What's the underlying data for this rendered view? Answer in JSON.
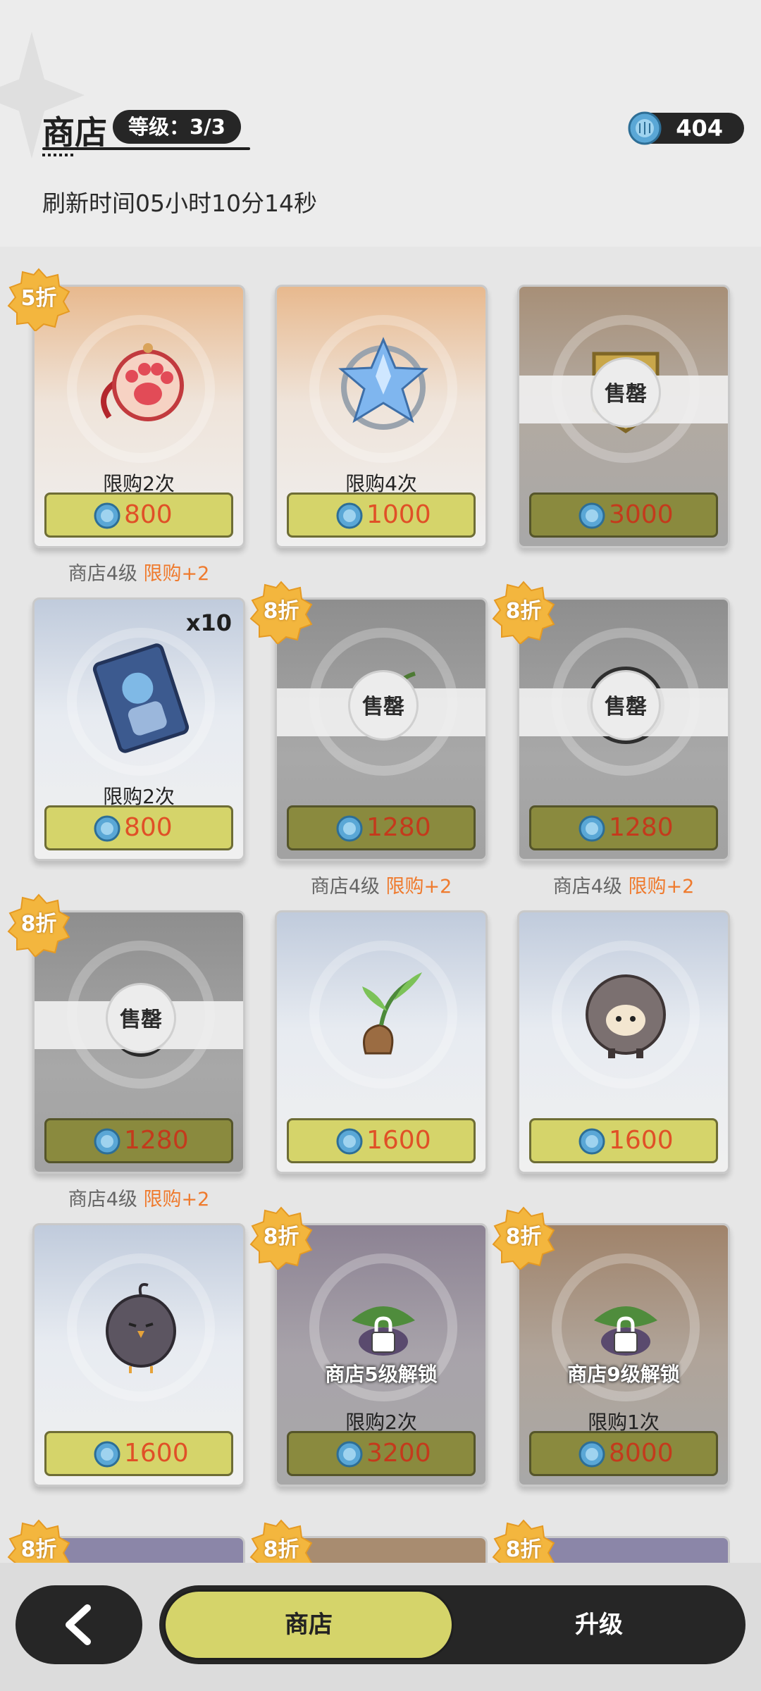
{
  "header": {
    "title": "商店",
    "level": "等级：3/3",
    "currency_amount": "404",
    "refresh_text": "刷新时间05小时10分14秒"
  },
  "items": [
    {
      "limit": "限购2次",
      "price": "800",
      "discount": "5折",
      "note_prefix": "商店4级",
      "note_highlight": "限购+2",
      "sold_out": false,
      "art": "paw-pendant-icon"
    },
    {
      "limit": "限购4次",
      "price": "1000",
      "sold_out": false,
      "art": "crystal-star-icon"
    },
    {
      "price": "3000",
      "sold_out": true,
      "sold_out_label": "售罄",
      "art": "badge-icon"
    },
    {
      "limit": "限购2次",
      "price": "800",
      "quantity": "x10",
      "sold_out": false,
      "art": "character-card-icon"
    },
    {
      "price": "1280",
      "discount": "8折",
      "sold_out": true,
      "sold_out_label": "售罄",
      "note_prefix": "商店4级",
      "note_highlight": "限购+2",
      "art": "sprout-icon"
    },
    {
      "price": "1280",
      "discount": "8折",
      "sold_out": true,
      "sold_out_label": "售罄",
      "note_prefix": "商店4级",
      "note_highlight": "限购+2",
      "art": "sheep-icon"
    },
    {
      "price": "1280",
      "discount": "8折",
      "sold_out": true,
      "sold_out_label": "售罄",
      "note_prefix": "商店4级",
      "note_highlight": "限购+2",
      "art": "bird-icon"
    },
    {
      "price": "1600",
      "sold_out": false,
      "art": "sprout-icon"
    },
    {
      "price": "1600",
      "sold_out": false,
      "art": "sheep-icon"
    },
    {
      "price": "1600",
      "sold_out": false,
      "art": "bird-icon"
    },
    {
      "limit": "限购2次",
      "price": "3200",
      "discount": "8折",
      "locked_label": "商店5级解锁",
      "art": "plant-bundle-icon"
    },
    {
      "limit": "限购1次",
      "price": "8000",
      "discount": "8折",
      "locked_label": "商店9级解锁",
      "art": "plant-bundle-icon"
    }
  ],
  "partial_row_discounts": [
    "8折",
    "8折",
    "8折"
  ],
  "bottom": {
    "tab_shop": "商店",
    "tab_upgrade": "升级"
  },
  "colors": {
    "price_bg": "#d5d46a",
    "price_text": "#e05027",
    "highlight": "#ef7a2d",
    "dark": "#262626"
  }
}
